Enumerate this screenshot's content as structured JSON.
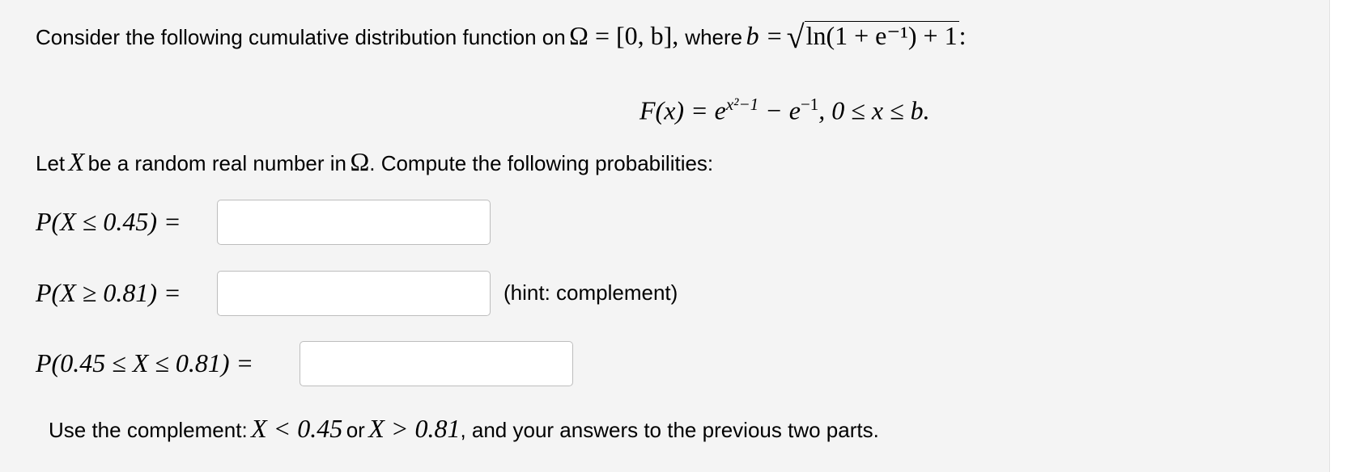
{
  "intro": {
    "lead": "Consider the following cumulative distribution function on",
    "omega": "Ω",
    "domain": " = [0, b], ",
    "where": "where",
    "b_eq": "b =",
    "radicand": "ln(1 + e⁻¹) + 1",
    "colon": ":"
  },
  "formula": {
    "lhs": "F(x) = e",
    "exp1": "x²−1",
    "mid": " − e",
    "exp2": "−1",
    "rhs": ", 0 ≤ x ≤ b."
  },
  "instruction": {
    "t1": "Let",
    "X": "X",
    "t2": "be a random real number in",
    "omega": "Ω",
    "t3": ". Compute the following probabilities:"
  },
  "questions": [
    {
      "label": "P(X ≤ 0.45) =",
      "value": "",
      "hint": ""
    },
    {
      "label": "P(X ≥ 0.81) =",
      "value": "",
      "hint": "(hint: complement)"
    },
    {
      "label": "P(0.45 ≤ X ≤ 0.81) =",
      "value": "",
      "hint": ""
    }
  ],
  "footer": {
    "t1": "Use the complement:",
    "m1": "X < 0.45",
    "t2": "or",
    "m2": "X > 0.81",
    "t3": ", and your answers to the previous two parts."
  }
}
